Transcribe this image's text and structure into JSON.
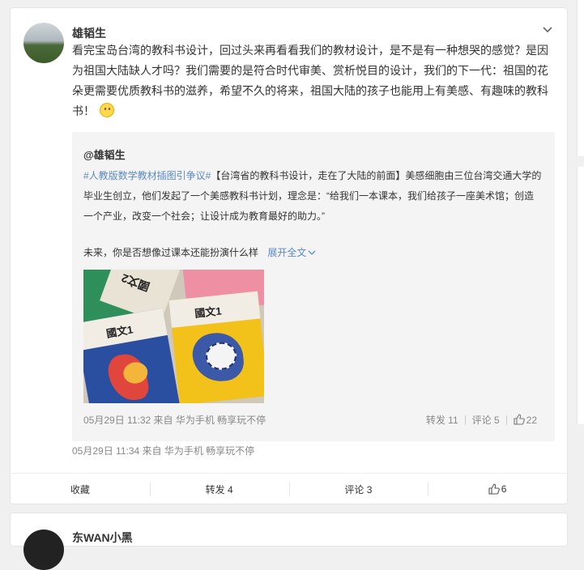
{
  "post": {
    "author": "雄韬生",
    "text": "看完宝岛台湾的教科书设计，回过头来再看看我们的教材设计，是不是有一种想哭的感觉？是因为祖国大陆缺人才吗？我们需要的是符合时代审美、赏析悦目的设计，我们的下一代：祖国的花朵更需要优质教科书的滋养，希望不久的将来，祖国大陆的孩子也能用上有美感、有趣味的教科书！",
    "emoji_icon": "smile-emoji-icon",
    "meta": "05月29日 11:34  来自 华为手机 畅享玩不停"
  },
  "repost": {
    "author": "@雄韬生",
    "hashtag": "#人教版数学教材插图引争议#",
    "text": "【台湾省的教科书设计，走在了大陆的前面】美感细胞由三位台湾交通大学的毕业生创立，他们发起了一个美感教科书计划，理念是：“给我们一本课本，我们给孩子一座美术馆；创造一个产业，改变一个社会；让设计成为教育最好的助力。”",
    "text2": "未来，你是否想像过课本还能扮演什么样",
    "expand": "展开全文",
    "image_titles": [
      "國文1",
      "國文1",
      "國文2"
    ],
    "meta": "05月29日 11:32  来自 华为手机 畅享玩不停",
    "repost_count": "转发 11",
    "comment_count": "评论 5",
    "like_count": "22"
  },
  "actions": {
    "favorite": "收藏",
    "repost": "转发 4",
    "comment": "评论 3",
    "like": "6"
  },
  "next_post": {
    "author": "东WAN小黑"
  },
  "colors": {
    "link": "#5a8ac6",
    "meta": "#888888",
    "repost_bg": "#f4f4f4"
  }
}
